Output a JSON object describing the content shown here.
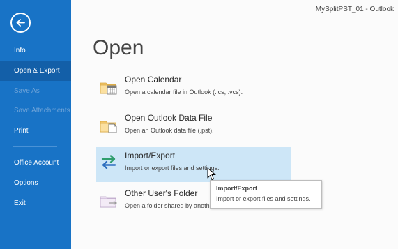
{
  "window": {
    "title": "MySplitPST_01 - Outlook"
  },
  "sidebar": {
    "back_icon": "back-arrow-icon",
    "items": [
      {
        "label": "Info",
        "state": "normal"
      },
      {
        "label": "Open & Export",
        "state": "active"
      },
      {
        "label": "Save As",
        "state": "disabled"
      },
      {
        "label": "Save Attachments",
        "state": "disabled"
      },
      {
        "label": "Print",
        "state": "normal"
      },
      {
        "label": "Office Account",
        "state": "normal"
      },
      {
        "label": "Options",
        "state": "normal"
      },
      {
        "label": "Exit",
        "state": "normal"
      }
    ]
  },
  "main": {
    "title": "Open",
    "options": [
      {
        "title": "Open Calendar",
        "desc": "Open a calendar file in Outlook (.ics, .vcs).",
        "icon": "calendar-folder-icon"
      },
      {
        "title": "Open Outlook Data File",
        "desc": "Open an Outlook data file (.pst).",
        "icon": "data-file-folder-icon"
      },
      {
        "title": "Import/Export",
        "desc": "Import or export files and settings.",
        "icon": "import-export-arrows-icon"
      },
      {
        "title": "Other User's Folder",
        "desc": "Open a folder shared by anoth",
        "icon": "shared-folder-icon"
      }
    ]
  },
  "tooltip": {
    "title": "Import/Export",
    "desc": "Import or export files and settings."
  },
  "colors": {
    "sidebar": "#1873c6",
    "sidebar_active": "#135fa8",
    "hover": "#cde6f7"
  }
}
